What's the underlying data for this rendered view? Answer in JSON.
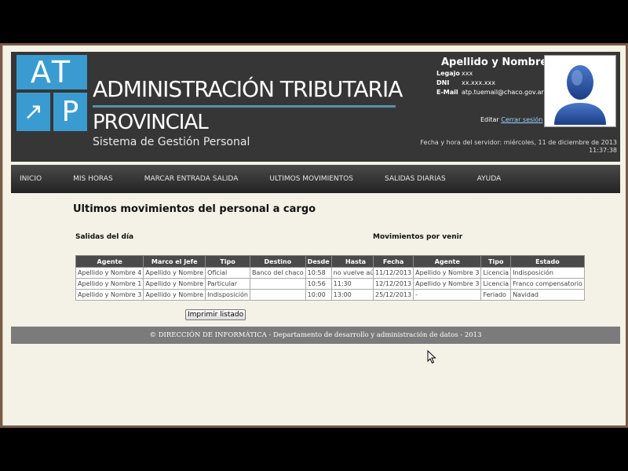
{
  "logo": {
    "a_letters": "AT",
    "arrow": "↗",
    "p_letter": "P"
  },
  "brand": {
    "line1": "ADMINISTRACIÓN TRIBUTARIA",
    "line2": "PROVINCIAL",
    "line3": "Sistema de Gestión Personal"
  },
  "user": {
    "name": "Apellido y Nombre",
    "legajo_label": "Legajo",
    "legajo_value": "xxx",
    "dni_label": "DNI",
    "dni_value": "xx.xxx.xxx",
    "email_label": "E-Mail",
    "email_value": "atp.tuemail@chaco.gov.ar",
    "edit": "Editar",
    "logout": "Cerrar sesión"
  },
  "server": {
    "line1": "Fecha y hora del servidor: miércoles, 11 de diciembre de 2013",
    "line2": "11:37:38"
  },
  "nav": [
    "INICIO",
    "MIS HORAS",
    "MARCAR ENTRADA SALIDA",
    "ULTIMOS MOVIMIENTOS",
    "SALIDAS DIARIAS",
    "AYUDA"
  ],
  "page_title": "Ultimos movimientos del personal a cargo",
  "salidas": {
    "title": "Salidas del día",
    "headers": [
      "Agente",
      "Marco el Jefe",
      "Tipo",
      "Destino",
      "Desde",
      "Hasta"
    ],
    "rows": [
      [
        "Apellido y Nombre 4",
        "Apellido y Nombre",
        "Oficial",
        "Banco del chaco",
        "10:58",
        "no vuelve aún"
      ],
      [
        "Apellido y Nombre 1",
        "Apellido y Nombre",
        "Particular",
        "",
        "10:56",
        "11:30"
      ],
      [
        "Apellido y Nombre 3",
        "Apellido y Nombre",
        "Indisposición",
        "",
        "10:00",
        "13:00"
      ]
    ]
  },
  "movimientos": {
    "title": "Movimientos por venir",
    "headers": [
      "Fecha",
      "Agente",
      "Tipo",
      "Estado"
    ],
    "rows": [
      [
        "11/12/2013",
        "Apellido y Nombre 3",
        "Licencia",
        "Indisposición"
      ],
      [
        "12/12/2013",
        "Apellido y Nombre 3",
        "Licencia",
        "Franco compensatorio"
      ],
      [
        "25/12/2013",
        "-",
        "Feriado",
        "Navidad"
      ]
    ]
  },
  "print_button": "Imprimir listado",
  "footer": "© DIRECCIÓN DE INFORMÁTICA - Departamento de desarrollo y administración de datos - 2013",
  "colors": {
    "header_bg": "#363636",
    "logo_blue": "#3a9bd0",
    "page_bg": "#f4f2e6",
    "nav_bg": "#2f2f2f",
    "footer_bg": "#7b7b7b",
    "link": "#9bd2ff"
  }
}
